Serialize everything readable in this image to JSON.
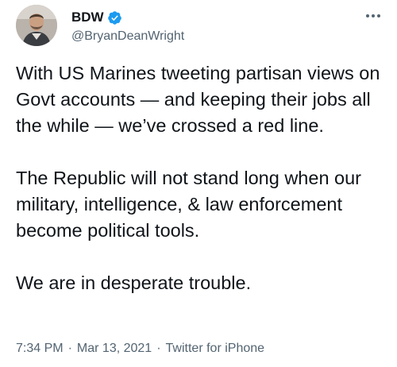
{
  "author": {
    "name": "BDW",
    "handle": "@BryanDeanWright",
    "verified": true
  },
  "icons": {
    "verified": "verified-badge-icon",
    "more": "more-options-icon"
  },
  "colors": {
    "text": "#0f1419",
    "secondary": "#536471",
    "verified_badge": "#1d9bf0"
  },
  "tweet": {
    "paragraphs": [
      "With US Marines tweeting partisan views on Govt accounts — and keeping their jobs all the while — we’ve crossed a red line.",
      "The Republic will not stand long when our military, intelligence, & law enforcement become political tools.",
      "We are in desperate trouble."
    ]
  },
  "meta": {
    "time": "7:34 PM",
    "separator": "·",
    "date": "Mar 13, 2021",
    "source": "Twitter for iPhone"
  }
}
